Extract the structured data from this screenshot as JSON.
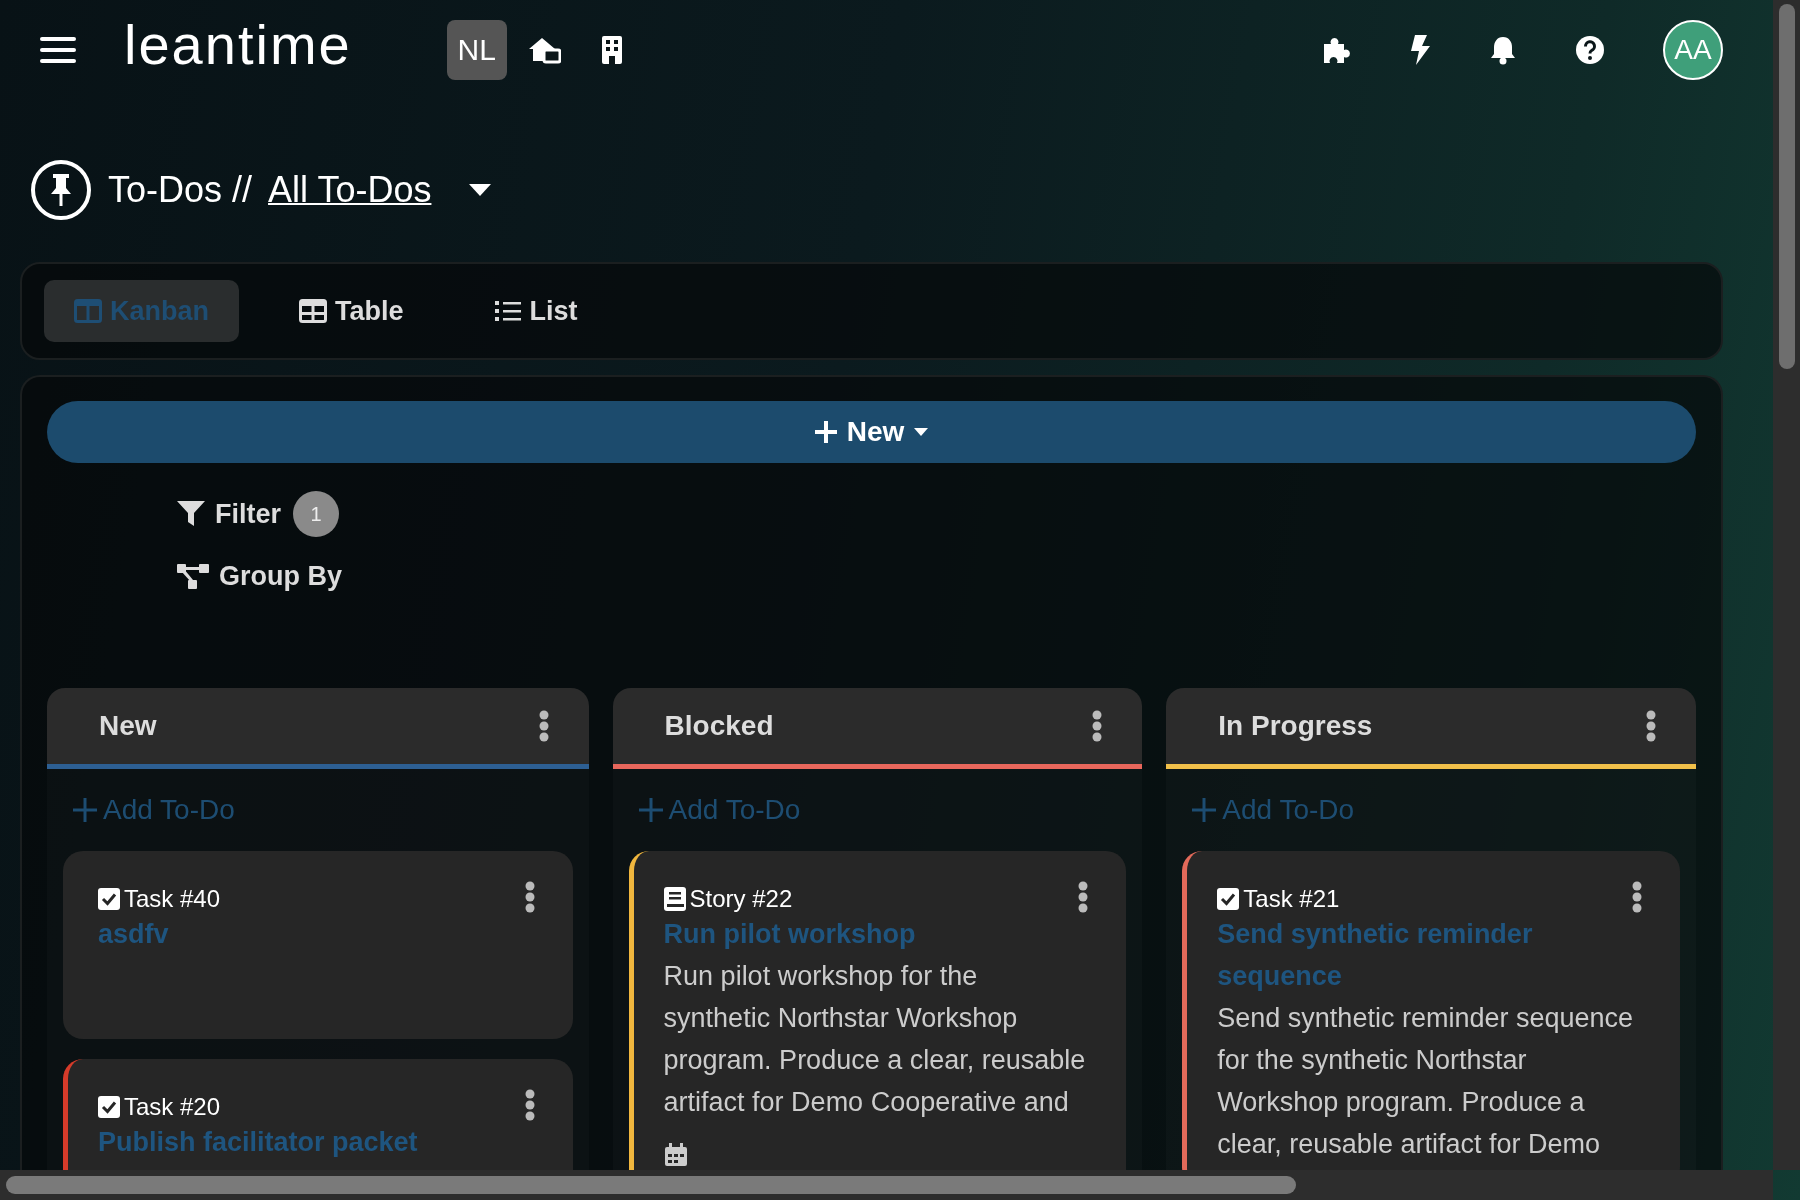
{
  "topbar": {
    "logo": "leantime",
    "project_badge": "NL",
    "avatar": "AA"
  },
  "breadcrumb": {
    "section": "To-Dos //",
    "view": "All To-Dos"
  },
  "tabs": [
    {
      "label": "Kanban",
      "kind": "kanban",
      "selected": true
    },
    {
      "label": "Table",
      "kind": "table",
      "selected": false
    },
    {
      "label": "List",
      "kind": "list",
      "selected": false
    }
  ],
  "new_button": "New",
  "filter": {
    "label": "Filter",
    "count": "1"
  },
  "group_by": "Group By",
  "columns": [
    {
      "name": "New",
      "color": "#2d5f93",
      "add_label": "Add To-Do",
      "cards": [
        {
          "kind": "task",
          "id": "Task #40",
          "title": "asdfv"
        },
        {
          "kind": "task",
          "id": "Task #20",
          "title": "Publish facilitator packet",
          "color": "#d63b2a"
        }
      ]
    },
    {
      "name": "Blocked",
      "color": "#e8675c",
      "add_label": "Add To-Do",
      "cards": [
        {
          "kind": "story",
          "id": "Story #22",
          "title": "Run pilot workshop",
          "description": "Run pilot workshop for the synthetic Northstar Workshop program. Produce a clear, reusable artifact for Demo Cooperative and",
          "color": "#f1b73e",
          "due_icon": true
        }
      ]
    },
    {
      "name": "In Progress",
      "color": "#f1c04a",
      "add_label": "Add To-Do",
      "cards": [
        {
          "kind": "task",
          "id": "Task #21",
          "title": "Send synthetic reminder sequence",
          "description": "Send synthetic reminder sequence for the synthetic Northstar Workshop program. Produce a clear, reusable artifact for Demo",
          "color": "#e36a5a"
        }
      ]
    }
  ]
}
